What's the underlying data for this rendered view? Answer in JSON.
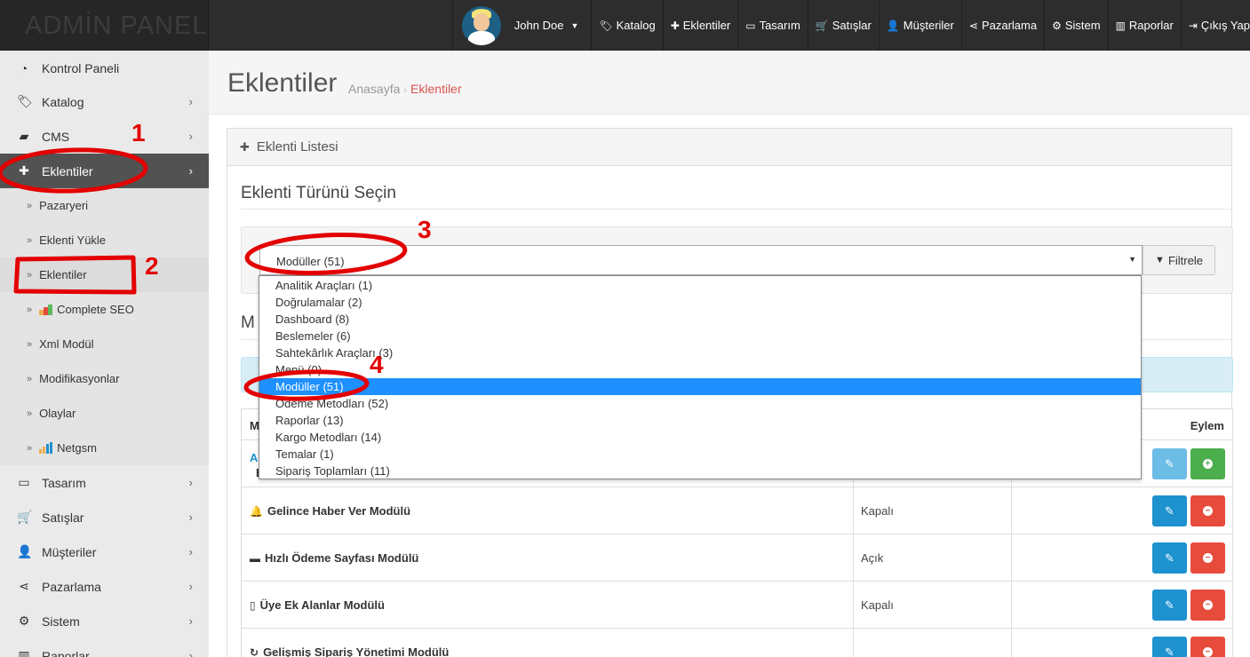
{
  "brand": "ADMİN PANEL",
  "user": {
    "name": "John Doe"
  },
  "topnav": [
    {
      "label": "Katalog",
      "icon": "tags-icon"
    },
    {
      "label": "Eklentiler",
      "icon": "puzzle-icon"
    },
    {
      "label": "Tasarım",
      "icon": "monitor-icon"
    },
    {
      "label": "Satışlar",
      "icon": "cart-icon"
    },
    {
      "label": "Müşteriler",
      "icon": "user-icon"
    },
    {
      "label": "Pazarlama",
      "icon": "share-icon"
    },
    {
      "label": "Sistem",
      "icon": "gear-icon"
    },
    {
      "label": "Raporlar",
      "icon": "bar-chart-icon"
    },
    {
      "label": "Çıkış Yap",
      "icon": "sign-out-icon"
    }
  ],
  "sidebar": {
    "items": [
      {
        "label": "Kontrol Paneli"
      },
      {
        "label": "Katalog"
      },
      {
        "label": "CMS"
      },
      {
        "label": "Eklentiler"
      },
      {
        "label": "Tasarım"
      },
      {
        "label": "Satışlar"
      },
      {
        "label": "Müşteriler"
      },
      {
        "label": "Pazarlama"
      },
      {
        "label": "Sistem"
      },
      {
        "label": "Raporlar"
      }
    ],
    "subitems": [
      {
        "label": "Pazaryeri"
      },
      {
        "label": "Eklenti Yükle"
      },
      {
        "label": "Eklentiler"
      },
      {
        "label": "Complete SEO"
      },
      {
        "label": "Xml Modül"
      },
      {
        "label": "Modifikasyonlar"
      },
      {
        "label": "Olaylar"
      },
      {
        "label": "Netgsm"
      }
    ]
  },
  "page": {
    "title": "Eklentiler",
    "breadcrumb": [
      "Anasayfa",
      "Eklentiler"
    ],
    "breadcrumb_sep": "›",
    "panel_title": "Eklenti Listesi",
    "section_title": "Eklenti Türünü Seçin",
    "section_title2_partial": "M",
    "filter_button": "Filtrele",
    "select_value": "Modüller (51)",
    "table": {
      "col_name_partial": "M",
      "col_action": "Eylem",
      "first_row_partial": "A",
      "first_row_partial2": "E",
      "rows": [
        {
          "name": "Gelince Haber Ver Modülü",
          "status": "Kapalı",
          "icon": "bell-icon"
        },
        {
          "name": "Hızlı Ödeme Sayfası Modülü",
          "status": "Açık",
          "icon": "credit-card-icon"
        },
        {
          "name": "Üye Ek Alanlar Modülü",
          "status": "Kapalı",
          "icon": "mobile-icon"
        },
        {
          "name": "Gelişmiş Sipariş Yönetimi Modülü",
          "status": "",
          "icon": "refresh-icon"
        }
      ]
    }
  },
  "dropdown": {
    "options": [
      "Analitik Araçları (1)",
      "Doğrulamalar (2)",
      "Dashboard (8)",
      "Beslemeler (6)",
      "Sahtekârlık Araçları (3)",
      "Menü (0)",
      "Modüller (51)",
      "Ödeme Metodları (52)",
      "Raporlar (13)",
      "Kargo Metodları (14)",
      "Temalar (1)",
      "Sipariş Toplamları (11)"
    ],
    "selected_index": 6
  },
  "annotations": {
    "n1": "1",
    "n2": "2",
    "n3": "3",
    "n4": "4",
    "color": "#e30000"
  }
}
